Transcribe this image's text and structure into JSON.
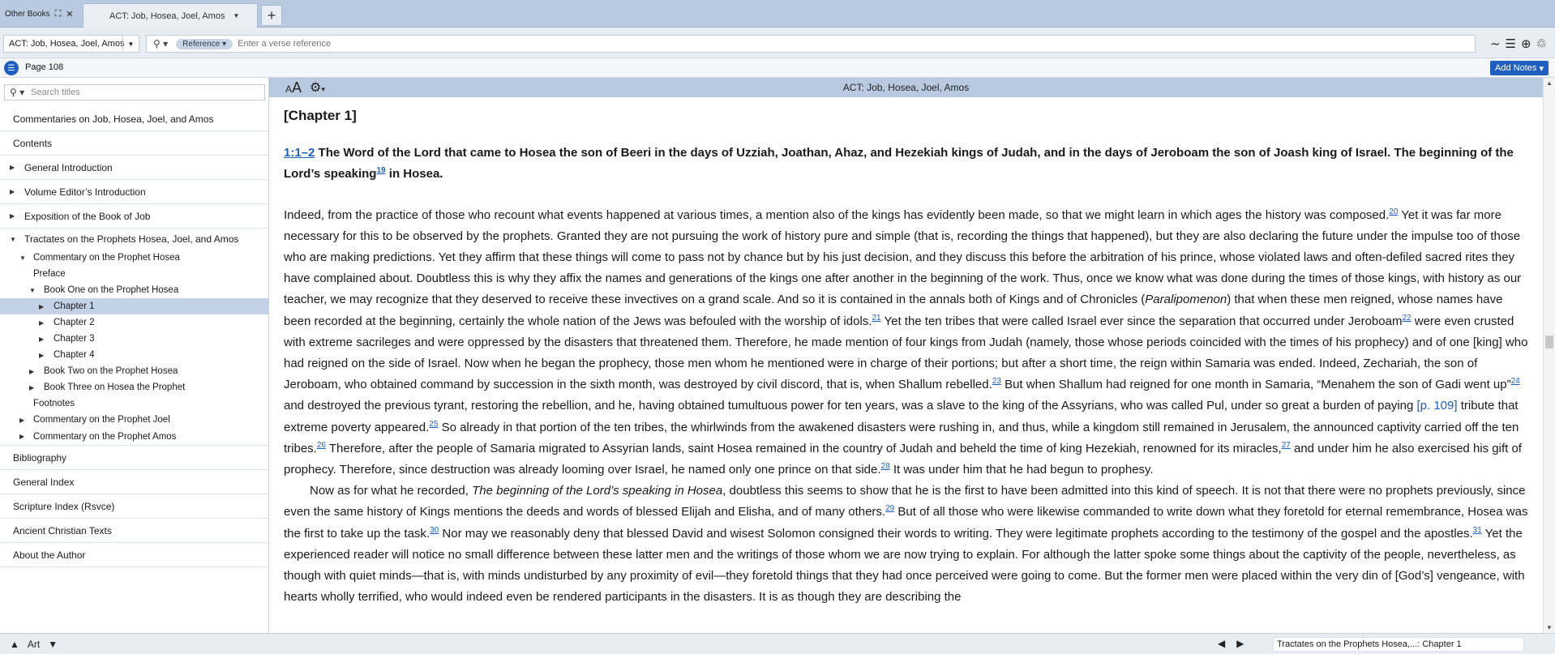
{
  "tabs": {
    "other_label": "Other Books",
    "active_label": "ACT: Job, Hosea, Joel, Amos"
  },
  "toolbar": {
    "book_selector": "ACT: Job, Hosea, Joel, Amos",
    "ref_pill": "Reference",
    "ref_placeholder": "Enter a verse reference"
  },
  "pagebar": {
    "page": "Page 108",
    "add_notes": "Add Notes"
  },
  "sidebar": {
    "search_placeholder": "Search titles",
    "items": [
      {
        "label": "Commentaries on Job, Hosea, Joel, and Amos"
      },
      {
        "label": "Contents"
      },
      {
        "label": "General Introduction"
      },
      {
        "label": "Volume Editor’s Introduction"
      },
      {
        "label": "Exposition of the Book of Job"
      },
      {
        "label": "Tractates on the Prophets Hosea, Joel, and Amos"
      },
      {
        "label": "Commentary on the Prophet Hosea"
      },
      {
        "label": "Preface"
      },
      {
        "label": "Book One on the Prophet Hosea"
      },
      {
        "label": "Chapter 1"
      },
      {
        "label": "Chapter 2"
      },
      {
        "label": "Chapter 3"
      },
      {
        "label": "Chapter 4"
      },
      {
        "label": "Book Two on the Prophet Hosea"
      },
      {
        "label": "Book Three on Hosea the Prophet"
      },
      {
        "label": "Footnotes"
      },
      {
        "label": "Commentary on the Prophet Joel"
      },
      {
        "label": "Commentary on the Prophet Amos"
      },
      {
        "label": "Bibliography"
      },
      {
        "label": "General Index"
      },
      {
        "label": "Scripture Index (Rsvce)"
      },
      {
        "label": "Ancient Christian Texts"
      },
      {
        "label": "About the Author"
      }
    ]
  },
  "article": {
    "header_title": "ACT: Job, Hosea, Joel, Amos",
    "aa_label": "AA",
    "chapter_heading": "[Chapter 1]",
    "verse_ref": "1:1–2",
    "verse_text": "The Word of the Lord that came to Hosea the son of Beeri in the days of Uzziah, Joathan, Ahaz, and Hezekiah kings of Judah, and in the days of Jeroboam the son of Joash king of Israel. The beginning of the Lord’s speaking",
    "verse_note": "19",
    "verse_tail": " in Hosea.",
    "p1_a": "Indeed, from the practice of those who recount what events happened at various times, a mention also of the kings has evidently been made, so that we might learn in which ages the history was composed.",
    "n20": "20",
    "p1_b": " Yet it was far more necessary for this to be observed by the prophets. Granted they are not pursuing the work of history pure and simple (that is, recording the things that happened), but they are also declaring the future under the impulse too of those who are making predictions. Yet they affirm that these things will come to pass not by chance but by his just decision, and they discuss this before the arbitration of his prince, whose violated laws and often-defiled sacred rites they have complained about. Doubtless this is why they affix the names and generations of the kings one after another in the beginning of the work. Thus, once we know what was done during the times of those kings, with history as our teacher, we may recognize that they deserved to receive these invectives on a grand scale. And so it is contained in the annals both of Kings and of Chronicles (",
    "p1_italic": "Paralipomenon",
    "p1_c": ") that when these men reigned, whose names have been recorded at the beginning, certainly the whole nation of the Jews was befouled with the worship of idols.",
    "n21": "21",
    "p1_d": " Yet the ten tribes that were called Israel ever since the separation that occurred under Jeroboam",
    "n22": "22",
    "p1_e": " were even crusted with extreme sacrileges and were oppressed by the disasters that threatened them. Therefore, he made mention of four kings from Judah (namely, those whose periods coincided with the times of his prophecy) and of one [king] who had reigned on the side of Israel. Now when he began the prophecy, those men whom he mentioned were in charge of their portions; but after a short time, the reign within Samaria was ended. Indeed, Zechariah, the son of Jeroboam, who obtained command by succession in the sixth month, was destroyed by civil discord, that is, when Shallum rebelled.",
    "n23": "23",
    "p1_f": " But when Shallum had reigned for one month in Samaria, “Menahem the son of Gadi went up”",
    "n24": "24",
    "p1_g": " and destroyed the previous tyrant, restoring the rebellion, and he, having obtained tumultuous power for ten years, was a slave to the king of the Assyrians, who was called Pul, under so great a burden of paying ",
    "page_marker": "[p. 109]",
    "p1_h": " tribute that extreme poverty appeared.",
    "n25": "25",
    "p1_i": " So already in that portion of the ten tribes, the whirlwinds from the awakened disasters were rushing in, and thus, while a kingdom still remained in Jerusalem, the announced captivity carried off the ten tribes.",
    "n26": "26",
    "p1_j": " Therefore, after the people of Samaria migrated to Assyrian lands, saint Hosea remained in the country of Judah and beheld the time of king Hezekiah, renowned for its miracles,",
    "n27": "27",
    "p1_k": " and under him he also exercised his gift of prophecy. Therefore, since destruction was already looming over Israel, he named only one prince on that side.",
    "n28": "28",
    "p1_l": " It was under him that he had begun to prophesy.",
    "p2_a": "Now as for what he recorded, ",
    "p2_italic": "The beginning of the Lord’s speaking in Hosea",
    "p2_b": ", doubtless this seems to show that he is the first to have been admitted into this kind of speech. It is not that there were no prophets previously, since even the same history of Kings mentions the deeds and words of blessed Elijah and Elisha, and of many others.",
    "n29": "29",
    "p2_c": " But of all those who were likewise commanded to write down what they foretold for eternal remembrance, Hosea was the first to take up the task.",
    "n30": "30",
    "p2_d": " Nor may we reasonably deny that blessed David and wisest Solomon consigned their words to writing. They were legitimate prophets according to the testimony of the gospel and the apostles.",
    "n31": "31",
    "p2_e": " Yet the experienced reader will notice no small difference between these latter men and the writings of those whom we are now trying to explain. For although the latter spoke some things about the captivity of the people, nevertheless, as though with quiet minds—that is, with minds undisturbed by any proximity of evil—they foretold things that they had once perceived were going to come. But the former men were placed within the very din of [God’s] vengeance, with hearts wholly terrified, who would indeed even be rendered participants in the disasters. It is as though they are describing the"
  },
  "status": {
    "art_label": "Art",
    "location": "Tractates on the Prophets Hosea,...: Chapter 1"
  }
}
